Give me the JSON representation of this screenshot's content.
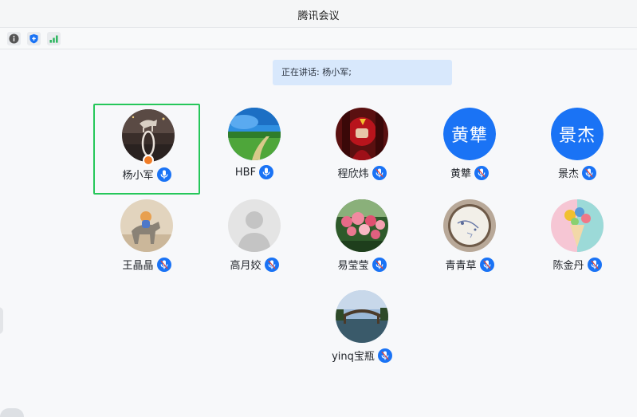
{
  "window": {
    "title": "腾讯会议"
  },
  "toolbar": {
    "icons": [
      {
        "name": "info-icon"
      },
      {
        "name": "security-shield-icon",
        "color": "#1a73f5"
      },
      {
        "name": "network-signal-icon",
        "color": "#26b45a"
      }
    ]
  },
  "banner": {
    "speaking_text": "正在讲话: 杨小军;"
  },
  "colors": {
    "accent": "#1a73f5",
    "active_border": "#26c75a",
    "host_badge": "#f07c27",
    "banner_bg": "#d8e8fc"
  },
  "participants": [
    {
      "name": "杨小军",
      "avatar": "photo-horse-statue",
      "host": true,
      "active": true,
      "mic_icon": "mic-on-icon"
    },
    {
      "name": "HBF",
      "avatar": "photo-field-path",
      "mic_icon": "mic-on-icon"
    },
    {
      "name": "程欣炜",
      "avatar": "photo-red-hero",
      "mic_icon": "mic-muted-icon"
    },
    {
      "name": "黄犨",
      "avatar_text": "黄犨",
      "mic_icon": "mic-muted-icon"
    },
    {
      "name": "景杰",
      "avatar_text": "景杰",
      "mic_icon": "mic-muted-icon"
    },
    {
      "name": "王晶晶",
      "avatar": "photo-cat-on-horse",
      "mic_icon": "mic-muted-icon"
    },
    {
      "name": "高月姣",
      "avatar": "default-person-silhouette",
      "mic_icon": "mic-muted-icon"
    },
    {
      "name": "易莹莹",
      "avatar": "photo-flowers",
      "mic_icon": "mic-muted-icon"
    },
    {
      "name": "青青草",
      "avatar": "photo-embroidery-hoop",
      "mic_icon": "mic-muted-icon"
    },
    {
      "name": "陈金丹",
      "avatar": "photo-ice-cream-flowers",
      "mic_icon": "mic-muted-icon"
    },
    {
      "name": "yinq宝瓶",
      "avatar": "photo-bridge-lake",
      "mic_icon": "mic-muted-icon"
    }
  ]
}
